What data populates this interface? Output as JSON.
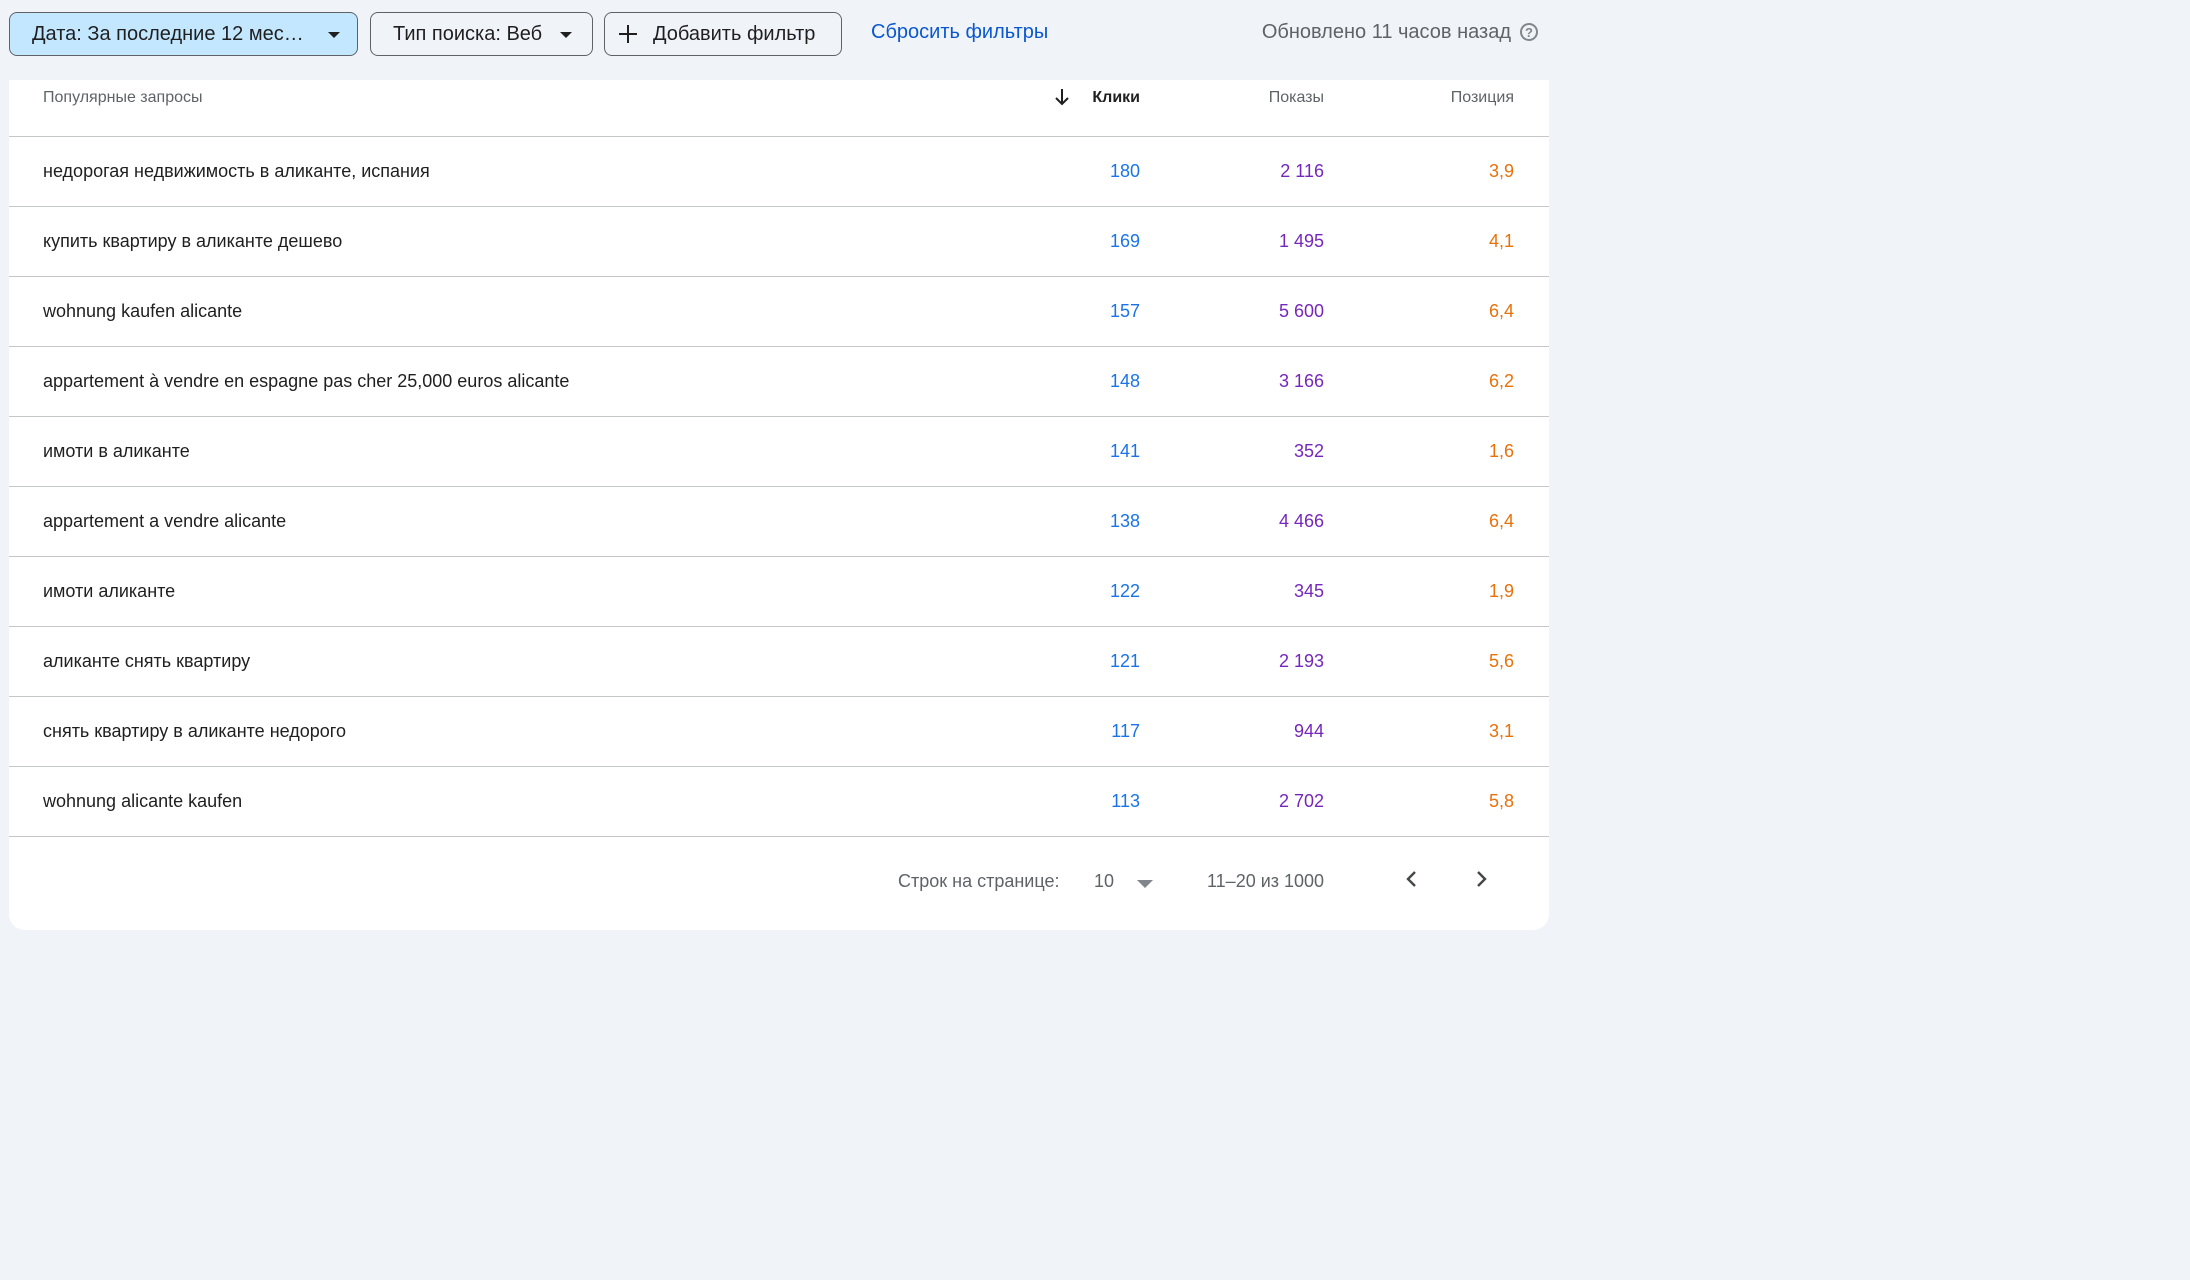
{
  "toolbar": {
    "date_filter": "Дата: За последние 12 мес…",
    "search_type_filter": "Тип поиска: Веб",
    "add_filter": "Добавить фильтр",
    "reset_filters": "Сбросить фильтры",
    "updated": "Обновлено 11 часов назад",
    "help_glyph": "?"
  },
  "colors": {
    "clicks": "#1a73e8",
    "impressions": "#7627bb",
    "position": "#e8710a",
    "link": "#0b57d0",
    "date_chip_bg": "#c2e7ff"
  },
  "table": {
    "headers": {
      "query": "Популярные запросы",
      "clicks": "Клики",
      "impressions": "Показы",
      "position": "Позиция"
    },
    "sort_icon": "arrow-down-icon",
    "rows": [
      {
        "query": "недорогая недвижимость в аликанте, испания",
        "clicks": "180",
        "impressions": "2 116",
        "position": "3,9"
      },
      {
        "query": "купить квартиру в аликанте дешево",
        "clicks": "169",
        "impressions": "1 495",
        "position": "4,1"
      },
      {
        "query": "wohnung kaufen alicante",
        "clicks": "157",
        "impressions": "5 600",
        "position": "6,4"
      },
      {
        "query": "appartement à vendre en espagne pas cher 25,000 euros alicante",
        "clicks": "148",
        "impressions": "3 166",
        "position": "6,2"
      },
      {
        "query": "имоти в аликанте",
        "clicks": "141",
        "impressions": "352",
        "position": "1,6"
      },
      {
        "query": "appartement a vendre alicante",
        "clicks": "138",
        "impressions": "4 466",
        "position": "6,4"
      },
      {
        "query": "имоти аликанте",
        "clicks": "122",
        "impressions": "345",
        "position": "1,9"
      },
      {
        "query": "аликанте снять квартиру",
        "clicks": "121",
        "impressions": "2 193",
        "position": "5,6"
      },
      {
        "query": "снять квартиру в аликанте недорого",
        "clicks": "117",
        "impressions": "944",
        "position": "3,1"
      },
      {
        "query": "wohnung alicante kaufen",
        "clicks": "113",
        "impressions": "2 702",
        "position": "5,8"
      }
    ]
  },
  "pagination": {
    "rows_per_page_label": "Строк на странице:",
    "rows_per_page_value": "10",
    "range": "11–20 из 1000"
  }
}
